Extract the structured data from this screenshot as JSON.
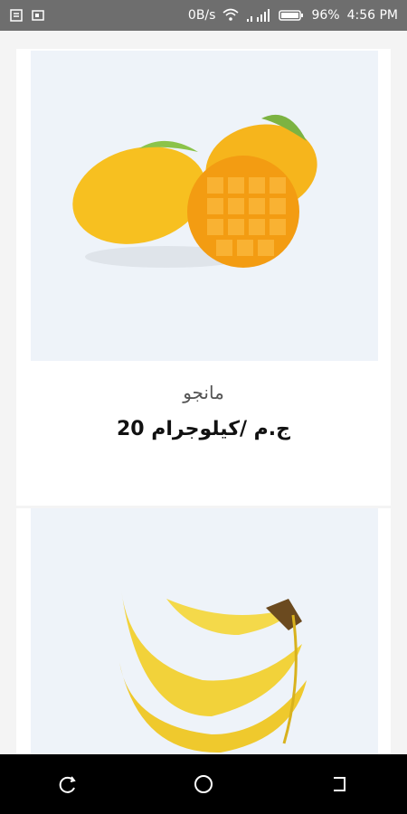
{
  "status_bar": {
    "net_speed": "0B/s",
    "battery": "96%",
    "time": "4:56 PM",
    "icons": [
      "notification-icon",
      "cast-icon",
      "wifi-icon",
      "signal-icon",
      "battery-icon"
    ]
  },
  "products": [
    {
      "name": "مانجو",
      "price": "20 ج.م /كيلوجرام",
      "image": "mango-image"
    },
    {
      "image": "banana-image"
    }
  ],
  "nav_bar": {
    "icons": [
      "recent-apps-icon",
      "home-icon",
      "back-icon"
    ]
  },
  "colors": {
    "status_bar": "#6e6e6e",
    "image_background": "#eef3f9",
    "nav_bar": "#000000",
    "mango": "#f5b515",
    "banana": "#f2d23a"
  }
}
